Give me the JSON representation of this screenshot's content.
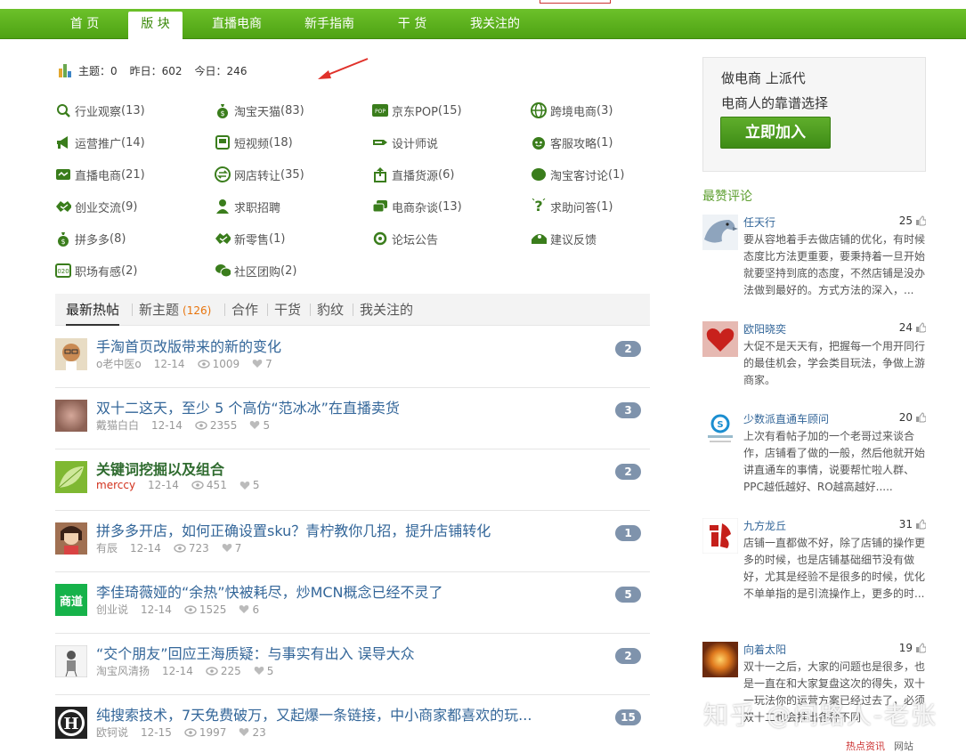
{
  "nav": {
    "items": [
      {
        "label": "首 页"
      },
      {
        "label": "版 块"
      },
      {
        "label": "直播电商"
      },
      {
        "label": "新手指南"
      },
      {
        "label": "干 货"
      },
      {
        "label": "我关注的"
      }
    ],
    "active_index": 1
  },
  "stats": {
    "topics": "主题：0",
    "yesterday": "昨日：602",
    "today": "今日：246"
  },
  "forums": [
    {
      "label": "行业观察",
      "count": "(13)",
      "icon": "magnifier-icon"
    },
    {
      "label": "淘宝天猫",
      "count": "(83)",
      "icon": "money-bag-icon"
    },
    {
      "label": "京东POP",
      "count": "(15)",
      "icon": "pop-icon"
    },
    {
      "label": "跨境电商",
      "count": "(3)",
      "icon": "globe-icon"
    },
    {
      "label": "运营推广",
      "count": "(14)",
      "icon": "megaphone-icon"
    },
    {
      "label": "短视频",
      "count": "(18)",
      "icon": "video-icon"
    },
    {
      "label": "设计师说",
      "count": "",
      "icon": "pencil-icon"
    },
    {
      "label": "客服攻略",
      "count": "(1)",
      "icon": "headset-icon"
    },
    {
      "label": "直播电商",
      "count": "(21)",
      "icon": "live-icon"
    },
    {
      "label": "网店转让",
      "count": "(35)",
      "icon": "transfer-icon"
    },
    {
      "label": "直播货源",
      "count": "(6)",
      "icon": "upload-icon"
    },
    {
      "label": "淘宝客讨论",
      "count": "(1)",
      "icon": "discuss-icon"
    },
    {
      "label": "创业交流",
      "count": "(9)",
      "icon": "handshake-icon"
    },
    {
      "label": "求职招聘",
      "count": "",
      "icon": "person-icon"
    },
    {
      "label": "电商杂谈",
      "count": "(13)",
      "icon": "chat-icon"
    },
    {
      "label": "求助问答",
      "count": "(1)",
      "icon": "question-icon"
    },
    {
      "label": "拼多多",
      "count": "(8)",
      "icon": "money-bag-icon"
    },
    {
      "label": "新零售",
      "count": "(1)",
      "icon": "handshake-icon"
    },
    {
      "label": "论坛公告",
      "count": "",
      "icon": "announcement-icon"
    },
    {
      "label": "建议反馈",
      "count": "",
      "icon": "feedback-icon"
    },
    {
      "label": "职场有感",
      "count": "(2)",
      "icon": "badge-icon"
    },
    {
      "label": "社区团购",
      "count": "(2)",
      "icon": "group-chat-icon"
    }
  ],
  "tabs": [
    {
      "label": "最新热帖",
      "count": ""
    },
    {
      "label": "新主题",
      "count": "(126)"
    },
    {
      "label": "合作",
      "count": ""
    },
    {
      "label": "干货",
      "count": ""
    },
    {
      "label": "豹纹",
      "count": ""
    },
    {
      "label": "我关注的",
      "count": ""
    }
  ],
  "threads": [
    {
      "title": "手淘首页改版带来的新的变化",
      "author": "o老中医o",
      "date": "12-14",
      "views": "1009",
      "likes": "7",
      "replies": "2",
      "avatar": "cartoon",
      "bold": false,
      "red_author": false
    },
    {
      "title": "双十二这天，至少 5 个高仿“范冰冰”在直播卖货",
      "author": "戴猫白白",
      "date": "12-14",
      "views": "2355",
      "likes": "5",
      "replies": "3",
      "avatar": "blur",
      "bold": false,
      "red_author": false
    },
    {
      "title": "关键词挖掘以及组合",
      "author": "merccy",
      "date": "12-14",
      "views": "451",
      "likes": "5",
      "replies": "2",
      "avatar": "leaf",
      "bold": true,
      "red_author": true
    },
    {
      "title": "拼多多开店，如何正确设置sku？青柠教你几招，提升店铺转化",
      "author": "有辰",
      "date": "12-14",
      "views": "723",
      "likes": "7",
      "replies": "1",
      "avatar": "girl",
      "bold": false,
      "red_author": false
    },
    {
      "title": "李佳琦薇娅的“余热”快被耗尽，炒MCN概念已经不灵了",
      "author": "创业说",
      "date": "12-14",
      "views": "1525",
      "likes": "6",
      "replies": "5",
      "avatar": "shangdao",
      "avatar_text": "商道",
      "bold": false,
      "red_author": false
    },
    {
      "title": "“交个朋友”回应王海质疑：与事实有出入 误导大众",
      "author": "淘宝风清扬",
      "date": "12-14",
      "views": "225",
      "likes": "5",
      "replies": "2",
      "avatar": "sketch",
      "bold": false,
      "red_author": false
    },
    {
      "title": "纯搜索技术，7天免费破万，又起爆一条链接，中小商家都喜欢的玩...",
      "author": "欧钶说",
      "date": "12-15",
      "views": "1997",
      "likes": "23",
      "replies": "15",
      "avatar": "h",
      "avatar_text": "H",
      "bold": false,
      "red_author": false
    }
  ],
  "promo": {
    "line1": "做电商 上派代",
    "line2": "电商人的靠谱选择",
    "button": "立即加入"
  },
  "hot_comments_label": "最赞评论",
  "comments": [
    {
      "name": "任天行",
      "likes": "25",
      "text": "要从容地着手去做店铺的优化，有时候态度比方法更重要，要秉持着一旦开始就要坚持到底的态度，不然店铺是没办法做到最好的。方式方法的深入，...",
      "avatar": "eagle"
    },
    {
      "name": "欧阳晓奕",
      "likes": "24",
      "text": "大促不是天天有，把握每一个用开同行的最佳机会，学会类目玩法，争做上游商家。",
      "avatar": "heart"
    },
    {
      "name": "少数派直通车顾问",
      "likes": "20",
      "text": "上次有看帖子加的一个老哥过来谈合作，店铺看了做的一般，然后他就开始讲直通车的事情，说要帮忙啦人群、PPC越低越好、RO越高越好.....",
      "avatar": "logo-s"
    },
    {
      "name": "九方龙丘",
      "likes": "31",
      "text": "店铺一直都做不好，除了店铺的操作更多的时候，也是店铺基础细节没有做好，尤其是经验不是很多的时候，优化不单单指的是引流操作上，更多的时...",
      "avatar": "dragon"
    },
    {
      "name": "向着太阳",
      "likes": "19",
      "text": "双十一之后，大家的问题也是很多，也是一直在和大家复盘这次的得失，双十一玩法你的运营方案已经过去了，必须双十二也会推出各种不同",
      "avatar": "sun"
    }
  ],
  "watermark": "知乎 @间路人-老张",
  "bottom_links": [
    "热点资讯",
    "网站"
  ]
}
